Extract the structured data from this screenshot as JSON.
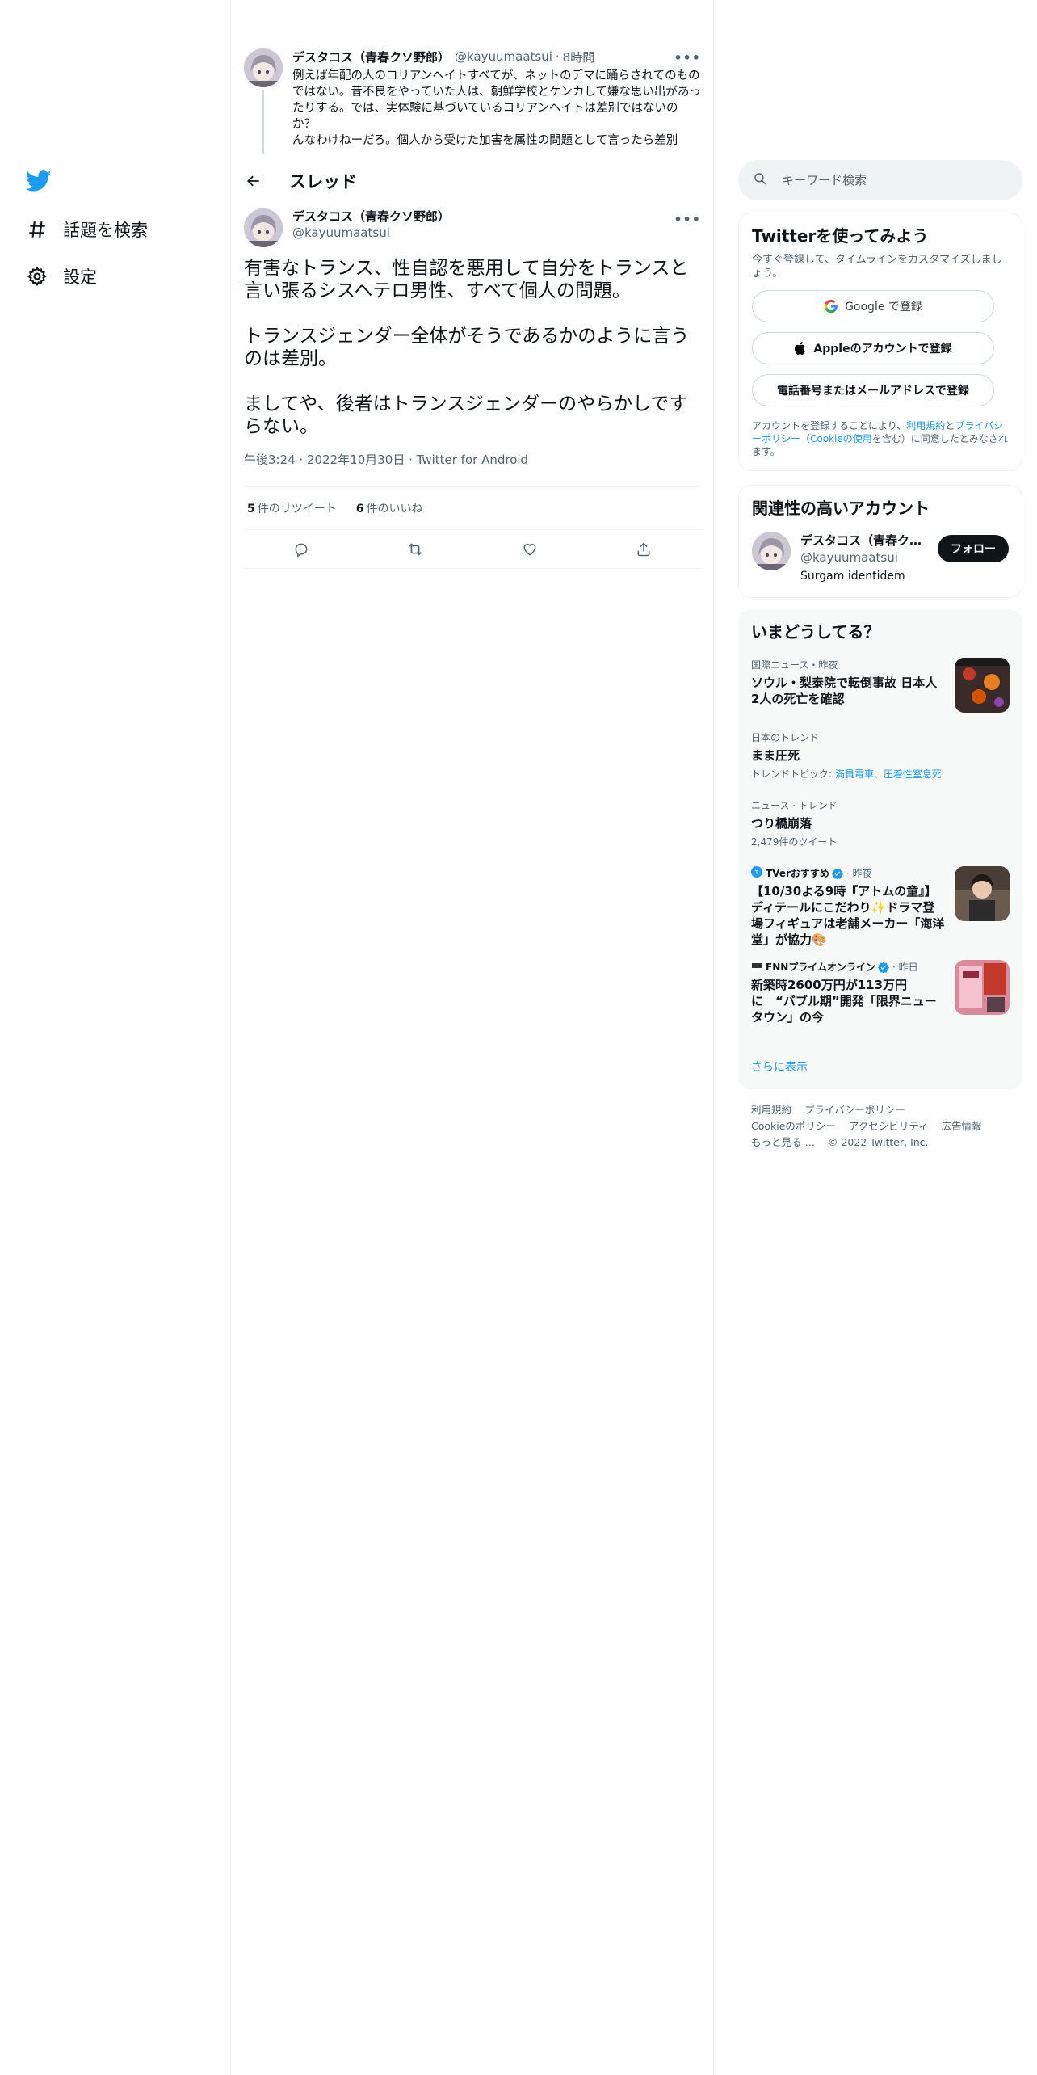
{
  "nav": {
    "logo": "twitter-bird-icon",
    "items": [
      {
        "label": "話題を検索",
        "icon": "hashtag-icon"
      },
      {
        "label": "設定",
        "icon": "gear-icon"
      }
    ]
  },
  "thread": {
    "header_title": "スレッド",
    "parent": {
      "name": "デスタコス（青春クソ野郎）",
      "handle": "@kayuumaatsui",
      "sep": "·",
      "time": "8時間",
      "text": "例えば年配の人のコリアンヘイトすべてが、ネットのデマに踊らされてのものではない。昔不良をやっていた人は、朝鮮学校とケンカして嫌な思い出があったりする。では、実体験に基づいているコリアンヘイトは差別ではないのか？\nんなわけねーだろ。個人から受けた加害を属性の問題として言ったら差別"
    },
    "main": {
      "name": "デスタコス（青春クソ野郎）",
      "handle": "@kayuumaatsui",
      "text": "有害なトランス、性自認を悪用して自分をトランスと言い張るシスヘテロ男性、すべて個人の問題。\n\nトランスジェンダー全体がそうであるかのように言うのは差別。\n\nましてや、後者はトランスジェンダーのやらかしですらない。",
      "timestamp": "午後3:24 · 2022年10月30日 · Twitter for Android",
      "retweets": "5",
      "retweets_label": "件のリツイート",
      "likes": "6",
      "likes_label": "件のいいね"
    }
  },
  "sidebar": {
    "search_placeholder": "キーワード検索",
    "signup": {
      "title": "Twitterを使ってみよう",
      "subtitle": "今すぐ登録して、タイムラインをカスタマイズしましょう。",
      "google_label": "Google で登録",
      "apple_label": "Appleのアカウントで登録",
      "phone_label": "電話番号またはメールアドレスで登録",
      "terms_prefix": "アカウントを登録することにより、",
      "terms_link": "利用規約",
      "terms_and": "と",
      "privacy_link": "プライバシーポリシー",
      "terms_mid": "（",
      "cookie_link": "Cookieの使用",
      "terms_suffix": "を含む）に同意したとみなされます。"
    },
    "related": {
      "title": "関連性の高いアカウント",
      "name": "デスタコス（青春クソ野郎）",
      "handle": "@kayuumaatsui",
      "bio": "Surgam identidem",
      "follow_label": "フォロー"
    },
    "trends": {
      "title": "いまどうしてる？",
      "items": [
        {
          "category": "国際ニュース・昨夜",
          "title": "ソウル・梨泰院で転倒事故 日本人2人の死亡を確認"
        },
        {
          "category": "日本のトレンド",
          "title": "まま圧死",
          "sub_prefix": "トレンドトピック: ",
          "sub_links": "満員電車、圧着性窒息死"
        },
        {
          "category": "ニュース · トレンド",
          "title": "つり橋崩落",
          "sub": "2,479件のツイート"
        },
        {
          "source": "TVerおすすめ",
          "time": "· 昨夜",
          "title": "【10/30よる9時『アトムの童』】ディテールにこだわり✨ドラマ登場フィギュアは老舗メーカー「海洋堂」が協力🎨"
        },
        {
          "source": "FNNプライムオンライン",
          "time": "· 昨日",
          "title": "新築時2600万円が113万円に　“バブル期”開発「限界ニュータウン」の今"
        }
      ],
      "show_more": "さらに表示"
    },
    "footer": {
      "links": [
        "利用規約",
        "プライバシーポリシー",
        "Cookieのポリシー",
        "アクセシビリティ",
        "広告情報",
        "もっと見る …",
        "© 2022 Twitter, Inc."
      ]
    }
  },
  "colors": {
    "accent": "#1d9bf0",
    "text": "#0f1419",
    "muted": "#536471",
    "border": "#eff3f4"
  }
}
